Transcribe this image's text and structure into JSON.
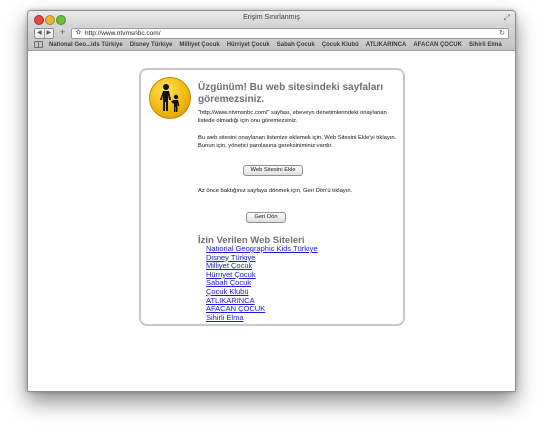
{
  "window": {
    "title": "Erişim Sınırlanmış"
  },
  "toolbar": {
    "back_icon": "back-arrow-icon",
    "forward_icon": "forward-arrow-icon",
    "plus": "+",
    "url": "http://www.ntvmsnbc.com/",
    "reload_icon": "reload-icon"
  },
  "bookmarks": [
    "National Geo...ids Türkiye",
    "Disney Türkiye",
    "Milliyet Çocuk",
    "Hürriyet Çocuk",
    "Sabah Çocuk",
    "Çocuk Klubü",
    "ATLIKARINCA",
    "AFACAN ÇOCUK",
    "Sihirli Elma"
  ],
  "page": {
    "heading": "Üzgünüm! Bu web sitesindeki sayfaları göremezsiniz.",
    "message": "\"http://www.ntvmsnbc.com/\" sayfası, ebeveyn denetimlerindeki onaylanan listede olmadığı için onu göremezsiniz.",
    "add_instructions": "Bu web sitesini onaylanan listenize eklemek için, Web Sitesini Ekle'yi tıklayın. Bunun için, yönetici parolasına gereksiniminiz vardır.",
    "add_button": "Web Sitesini Ekle",
    "back_instructions": "Az önce baktığınız sayfaya dönmek için, Geri Dön'ü tıklayın.",
    "back_button": "Geri Dön",
    "allowed_title": "İzin Verilen Web Siteleri",
    "allowed_sites": [
      "National Geographic Kids Türkiye",
      "Disney Türkiye",
      "Milliyet Çocuk",
      "Hürriyet Çocuk",
      "Sabah Çocuk",
      "Çocuk Klubü",
      "ATLIKARINCA",
      "AFACAN ÇOCUK",
      "Sihirli Elma"
    ]
  },
  "colors": {
    "link": "#1a1ad8",
    "icon_yellow": "#f2b90f",
    "heading_gray": "#6f6f6f"
  }
}
